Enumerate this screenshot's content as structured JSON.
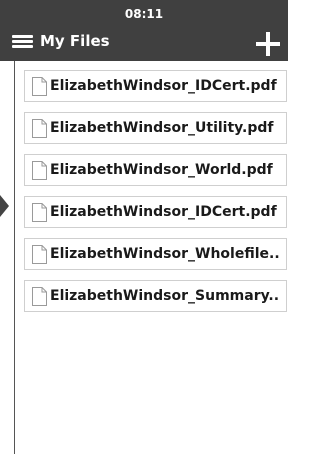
{
  "status_bar": {
    "time": "08:11"
  },
  "header": {
    "title": "My Files",
    "menu_icon": "hamburger-menu-icon",
    "add_icon": "plus-icon"
  },
  "files": [
    {
      "name": "ElizabethWindsor_IDCert.pdf"
    },
    {
      "name": "ElizabethWindsor_Utility.pdf"
    },
    {
      "name": "ElizabethWindsor_World.pdf"
    },
    {
      "name": "ElizabethWindsor_IDCert.pdf"
    },
    {
      "name": "ElizabethWindsor_Wholefile.."
    },
    {
      "name": "ElizabethWindsor_Summary.."
    }
  ],
  "colors": {
    "header_bg": "#404040",
    "header_text": "#ffffff",
    "item_border": "#cfcfcf",
    "item_text": "#1a1a1a"
  }
}
